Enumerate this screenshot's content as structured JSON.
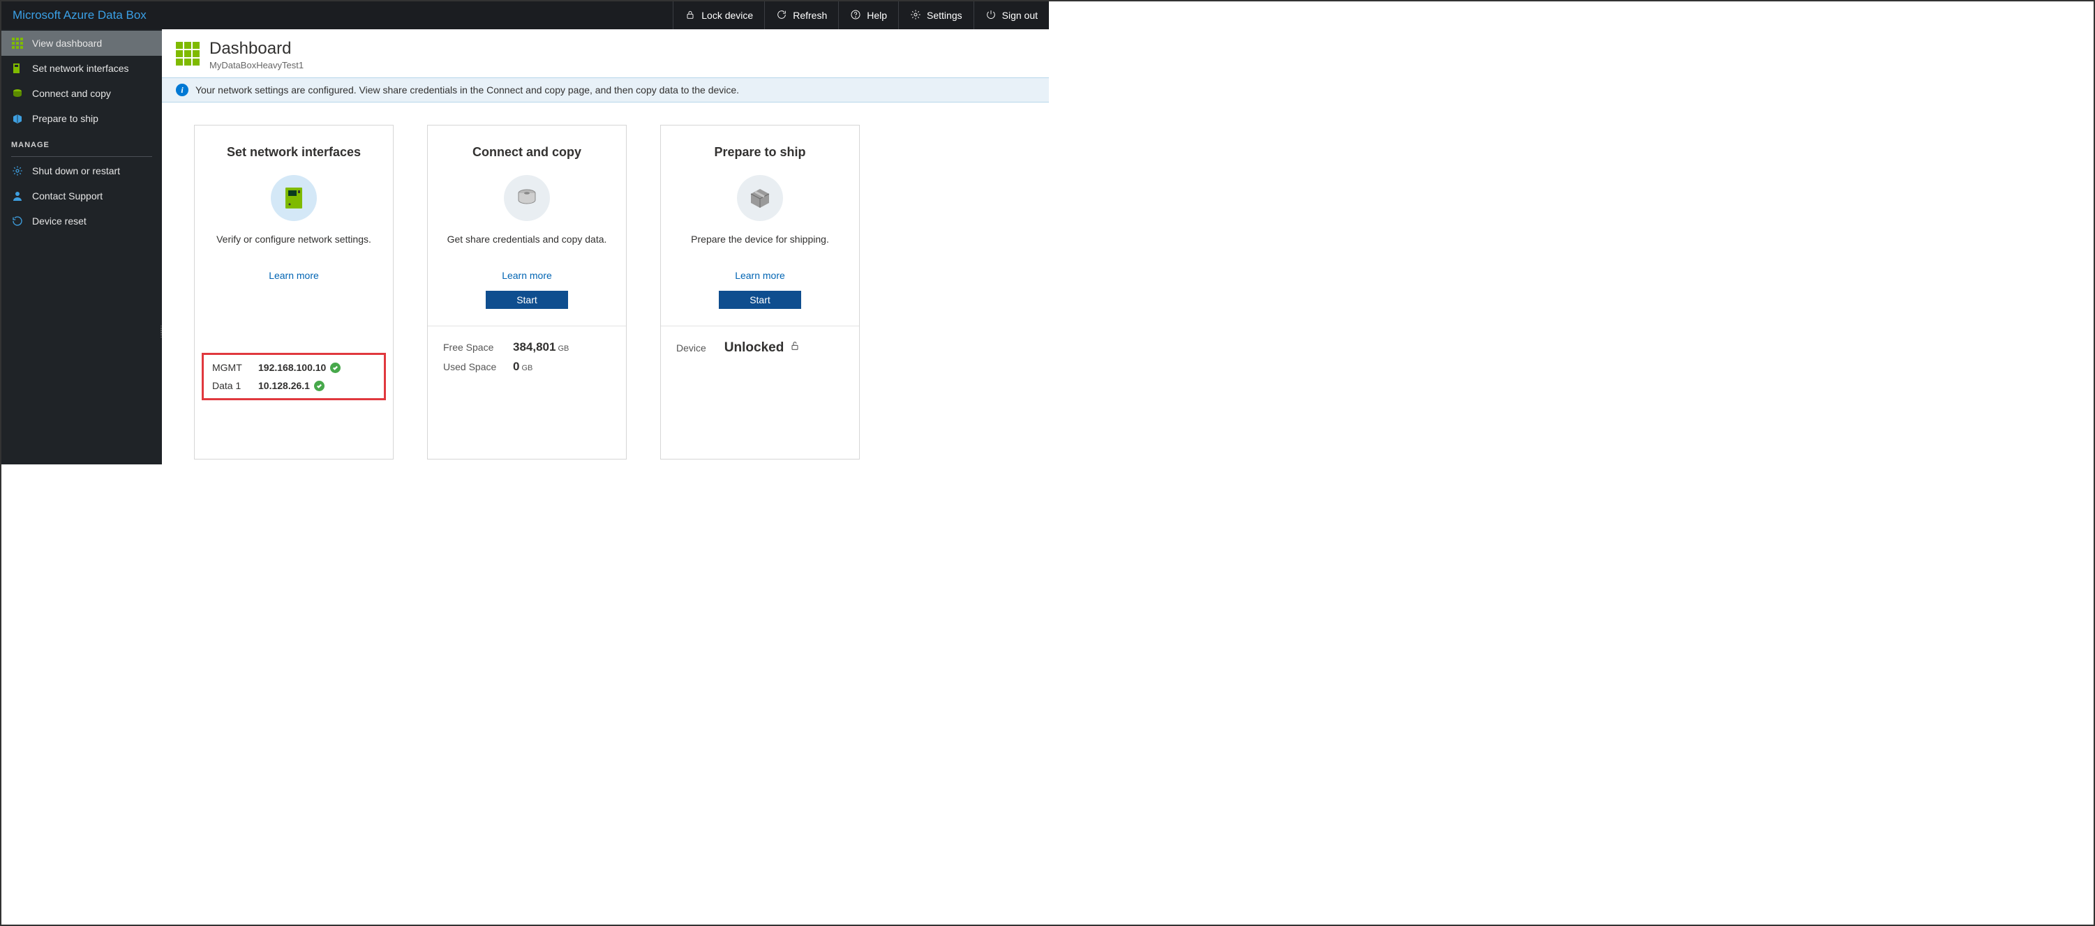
{
  "brand": "Microsoft Azure Data Box",
  "topbar": {
    "lock": "Lock device",
    "refresh": "Refresh",
    "help": "Help",
    "settings": "Settings",
    "signout": "Sign out"
  },
  "sidebar": {
    "items": [
      {
        "label": "View dashboard"
      },
      {
        "label": "Set network interfaces"
      },
      {
        "label": "Connect and copy"
      },
      {
        "label": "Prepare to ship"
      }
    ],
    "section": "MANAGE",
    "manage": [
      {
        "label": "Shut down or restart"
      },
      {
        "label": "Contact Support"
      },
      {
        "label": "Device reset"
      }
    ]
  },
  "page": {
    "title": "Dashboard",
    "subtitle": "MyDataBoxHeavyTest1",
    "banner": "Your network settings are configured. View share credentials in the Connect and copy page, and then copy data to the device."
  },
  "cards": {
    "network": {
      "title": "Set network interfaces",
      "desc": "Verify or configure network settings.",
      "learn": "Learn more",
      "interfaces": [
        {
          "name": "MGMT",
          "ip": "192.168.100.10"
        },
        {
          "name": "Data 1",
          "ip": "10.128.26.1"
        }
      ]
    },
    "copy": {
      "title": "Connect and copy",
      "desc": "Get share credentials and copy data.",
      "learn": "Learn more",
      "start": "Start",
      "free_label": "Free Space",
      "free_value": "384,801",
      "free_unit": "GB",
      "used_label": "Used Space",
      "used_value": "0",
      "used_unit": "GB"
    },
    "ship": {
      "title": "Prepare to ship",
      "desc": "Prepare the device for shipping.",
      "learn": "Learn more",
      "start": "Start",
      "device_label": "Device",
      "device_status": "Unlocked"
    }
  }
}
